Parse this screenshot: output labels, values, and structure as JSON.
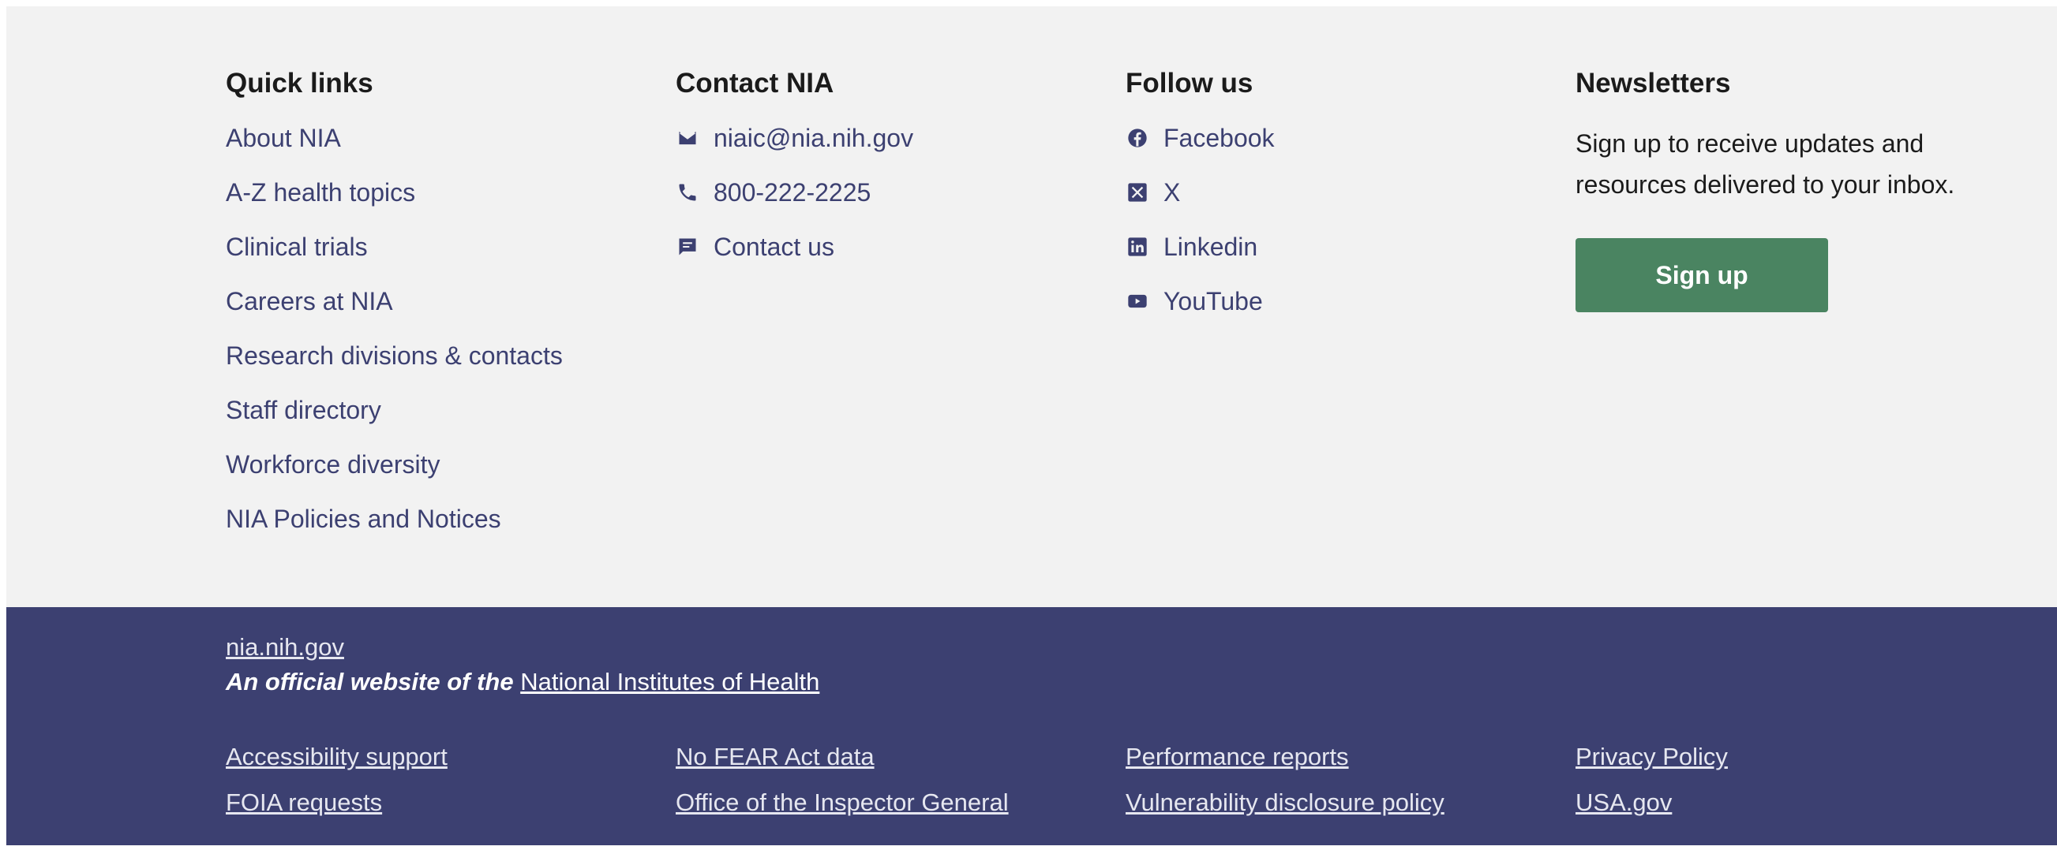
{
  "quick_links": {
    "heading": "Quick links",
    "items": [
      "About NIA",
      "A-Z health topics",
      "Clinical trials",
      "Careers at NIA",
      "Research divisions & contacts",
      "Staff directory",
      "Workforce diversity",
      "NIA Policies and Notices"
    ]
  },
  "contact": {
    "heading": "Contact NIA",
    "items": [
      {
        "icon": "email-icon",
        "label": "niaic@nia.nih.gov"
      },
      {
        "icon": "phone-icon",
        "label": "800-222-2225"
      },
      {
        "icon": "chat-icon",
        "label": "Contact us"
      }
    ]
  },
  "follow": {
    "heading": "Follow us",
    "items": [
      {
        "icon": "facebook-icon",
        "label": "Facebook"
      },
      {
        "icon": "x-icon",
        "label": "X"
      },
      {
        "icon": "linkedin-icon",
        "label": "Linkedin"
      },
      {
        "icon": "youtube-icon",
        "label": "YouTube"
      }
    ]
  },
  "newsletters": {
    "heading": "Newsletters",
    "text": "Sign up to receive updates and resources delivered to your inbox.",
    "button_label": "Sign up"
  },
  "bottom": {
    "site": "nia.nih.gov",
    "official_prefix": "An official website of the",
    "official_link": "National Institutes of Health",
    "columns": [
      [
        "Accessibility support",
        "FOIA requests"
      ],
      [
        "No FEAR Act data",
        "Office of the Inspector General"
      ],
      [
        "Performance reports",
        "Vulnerability disclosure policy"
      ],
      [
        "Privacy Policy",
        "USA.gov"
      ]
    ]
  },
  "colors": {
    "top_background": "#f2f2f2",
    "bottom_background": "#3c4071",
    "link": "#3c4071",
    "button": "#4a8461"
  }
}
